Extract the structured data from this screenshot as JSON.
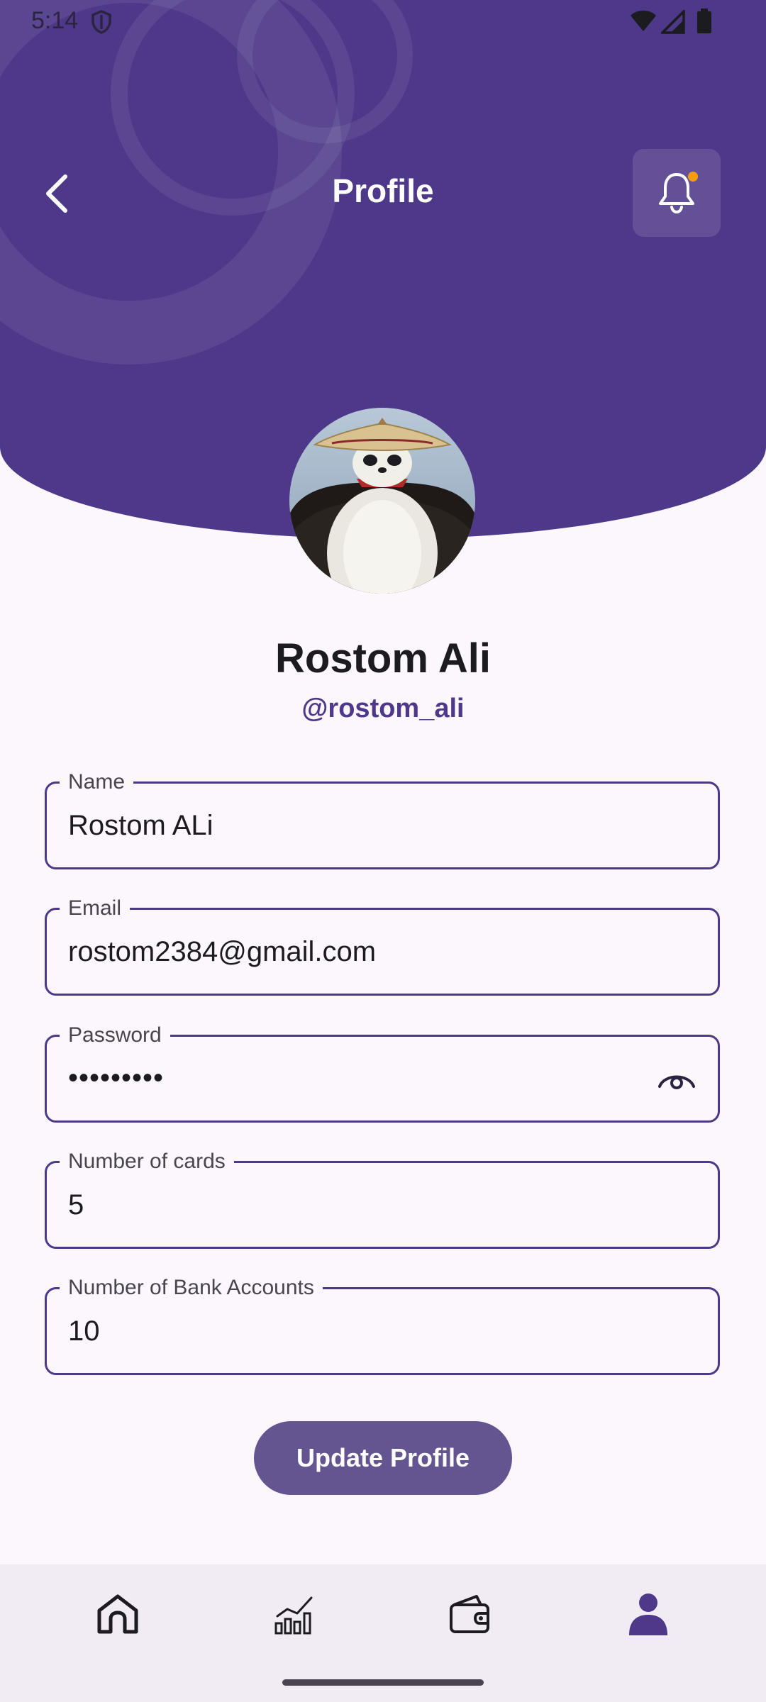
{
  "status_bar": {
    "time": "5:14"
  },
  "header": {
    "title": "Profile",
    "accent_color": "#4e3889",
    "notification_dot_color": "#f59e0b"
  },
  "profile": {
    "name": "Rostom Ali",
    "handle": "@rostom_ali"
  },
  "form": {
    "name": {
      "label": "Name",
      "value": "Rostom ALi"
    },
    "email": {
      "label": "Email",
      "value": "rostom2384@gmail.com"
    },
    "password": {
      "label": "Password",
      "value": "•••••••••"
    },
    "cards": {
      "label": "Number of cards",
      "value": "5"
    },
    "bank_accounts": {
      "label": "Number of Bank Accounts",
      "value": "10"
    }
  },
  "actions": {
    "update_label": "Update Profile"
  },
  "bottom_nav": {
    "items": [
      {
        "icon": "home-icon",
        "active": false
      },
      {
        "icon": "chart-icon",
        "active": false
      },
      {
        "icon": "wallet-icon",
        "active": false
      },
      {
        "icon": "person-icon",
        "active": true
      }
    ]
  }
}
